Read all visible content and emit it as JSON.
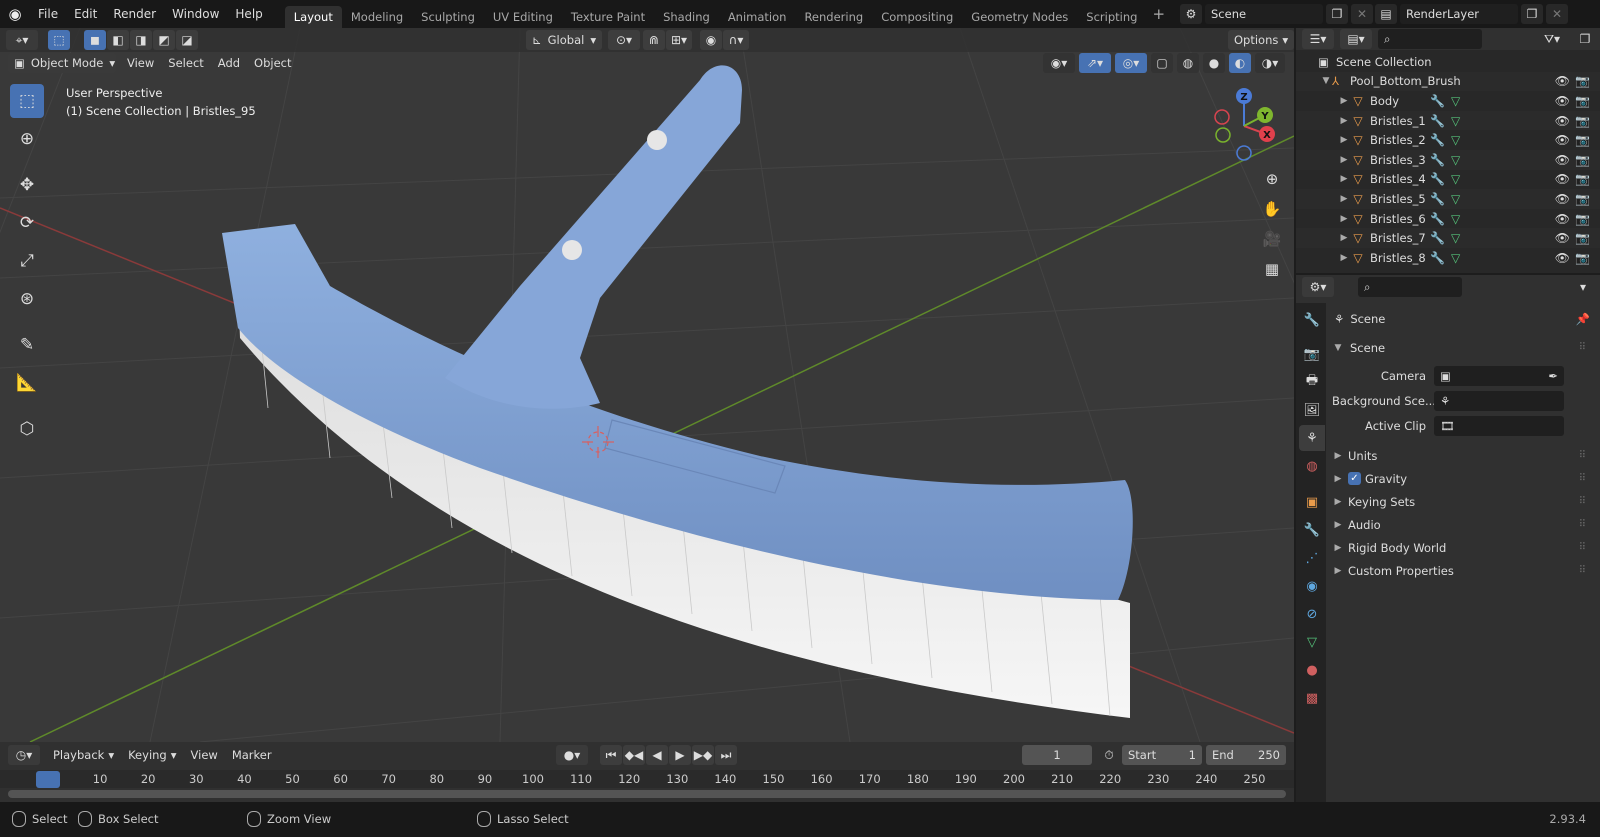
{
  "menus": [
    "File",
    "Edit",
    "Render",
    "Window",
    "Help"
  ],
  "workspaces": [
    "Layout",
    "Modeling",
    "Sculpting",
    "UV Editing",
    "Texture Paint",
    "Shading",
    "Animation",
    "Rendering",
    "Compositing",
    "Geometry Nodes",
    "Scripting"
  ],
  "active_workspace": "Layout",
  "scene_name": "Scene",
  "view_layer": "RenderLayer",
  "viewport": {
    "transform_orientation": "Global",
    "options_label": "Options",
    "mode": "Object Mode",
    "header_menus": [
      "View",
      "Select",
      "Add",
      "Object"
    ],
    "overlay_line1": "User Perspective",
    "overlay_line2": "(1) Scene Collection | Bristles_95",
    "gizmo": {
      "x": "X",
      "y": "Y",
      "z": "Z"
    }
  },
  "outliner": {
    "root": "Scene Collection",
    "parent": "Pool_Bottom_Brush",
    "items": [
      "Body",
      "Bristles_1",
      "Bristles_2",
      "Bristles_3",
      "Bristles_4",
      "Bristles_5",
      "Bristles_6",
      "Bristles_7",
      "Bristles_8"
    ]
  },
  "properties": {
    "context_title": "Scene",
    "section": "Scene",
    "fields": [
      {
        "label": "Camera",
        "value": ""
      },
      {
        "label": "Background Sce...",
        "value": ""
      },
      {
        "label": "Active Clip",
        "value": ""
      }
    ],
    "collapsed": [
      {
        "label": "Units",
        "checkbox": false
      },
      {
        "label": "Gravity",
        "checkbox": true
      },
      {
        "label": "Keying Sets",
        "checkbox": false
      },
      {
        "label": "Audio",
        "checkbox": false
      },
      {
        "label": "Rigid Body World",
        "checkbox": false
      },
      {
        "label": "Custom Properties",
        "checkbox": false
      }
    ]
  },
  "timeline": {
    "menus": [
      "Playback",
      "Keying",
      "View",
      "Marker"
    ],
    "current_frame": "1",
    "start_label": "Start",
    "start": "1",
    "end_label": "End",
    "end": "250",
    "ticks": [
      "1",
      "10",
      "20",
      "30",
      "40",
      "50",
      "60",
      "70",
      "80",
      "90",
      "100",
      "110",
      "120",
      "130",
      "140",
      "150",
      "160",
      "170",
      "180",
      "190",
      "200",
      "210",
      "220",
      "230",
      "240",
      "250"
    ]
  },
  "statusbar": {
    "select": "Select",
    "box_select": "Box Select",
    "zoom_view": "Zoom View",
    "lasso_select": "Lasso Select",
    "version": "2.93.4"
  },
  "colors": {
    "accent": "#4772b3",
    "object": "#e89b4b",
    "modifier": "#5fa8e0",
    "mesh": "#55c27a",
    "brush": "#7a9acc"
  }
}
